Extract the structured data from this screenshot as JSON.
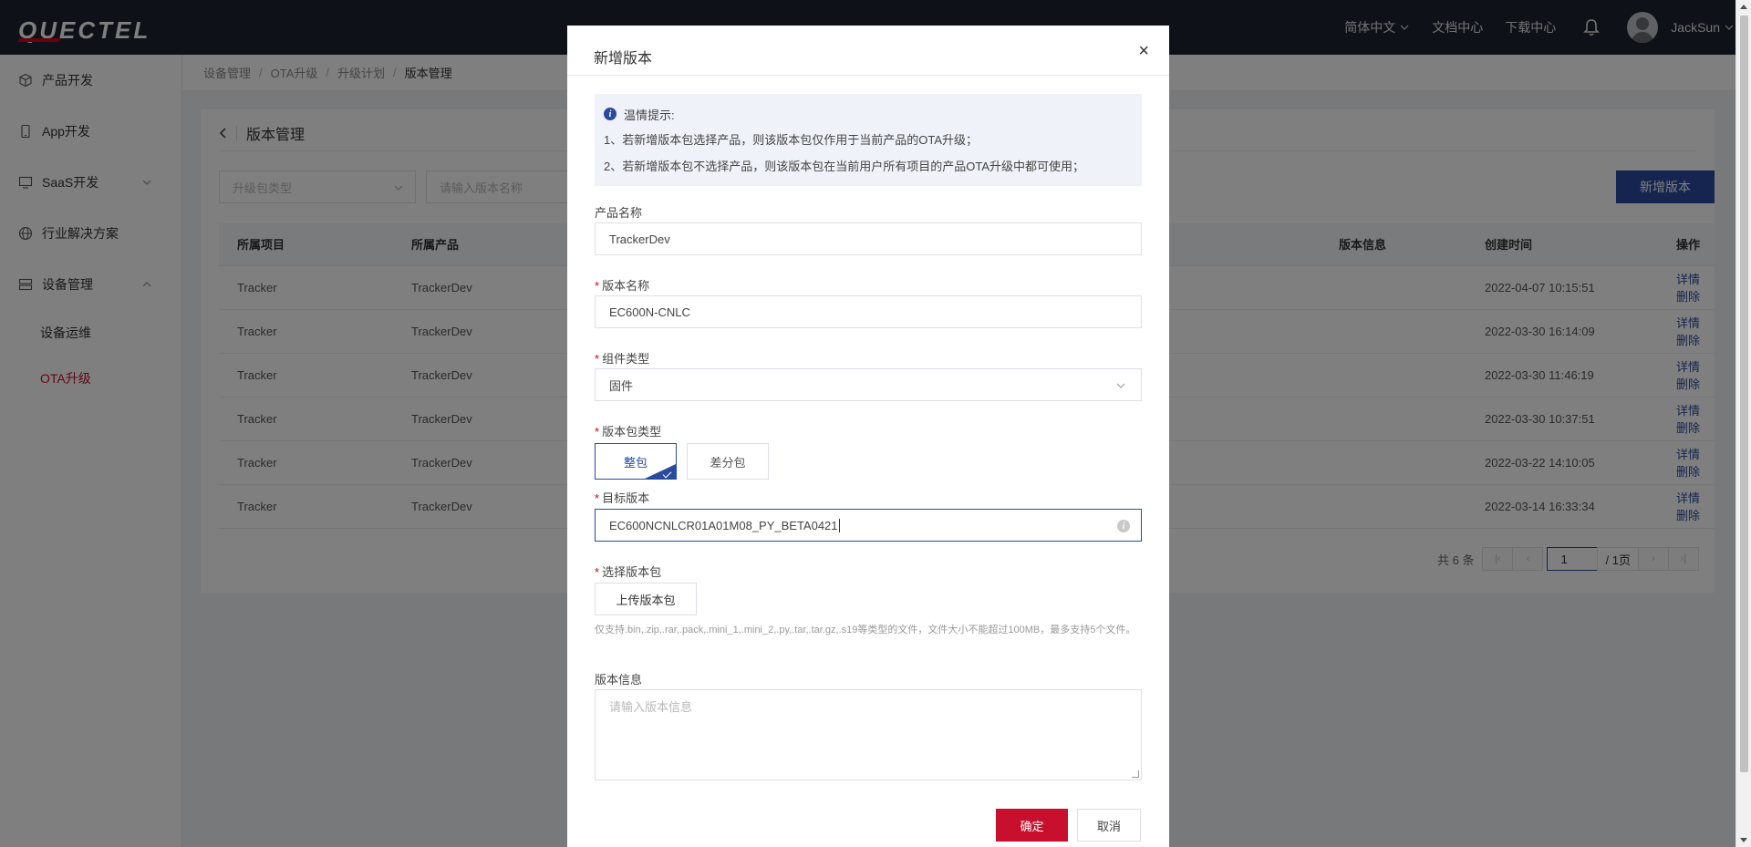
{
  "header": {
    "logo": "QUECTEL",
    "language": "简体中文",
    "docs": "文档中心",
    "downloads": "下载中心",
    "username": "JackSun"
  },
  "sidebar": {
    "items": [
      {
        "label": "产品开发",
        "icon": "cube-icon"
      },
      {
        "label": "App开发",
        "icon": "phone-icon"
      },
      {
        "label": "SaaS开发",
        "icon": "monitor-icon"
      },
      {
        "label": "行业解决方案",
        "icon": "globe-icon"
      },
      {
        "label": "设备管理",
        "icon": "grid-icon"
      }
    ],
    "sub_items": [
      {
        "label": "设备运维"
      },
      {
        "label": "OTA升级"
      }
    ]
  },
  "breadcrumb": [
    "设备管理",
    "OTA升级",
    "升级计划",
    "版本管理"
  ],
  "page": {
    "title": "版本管理",
    "filter_type_placeholder": "升级包类型",
    "filter_name_placeholder": "请输入版本名称",
    "add_button": "新增版本"
  },
  "table": {
    "columns": [
      "所属项目",
      "所属产品",
      "版本信息",
      "创建时间",
      "操作"
    ],
    "rows": [
      {
        "project": "Tracker",
        "product": "TrackerDev",
        "info": "",
        "created": "2022-04-07 10:15:51"
      },
      {
        "project": "Tracker",
        "product": "TrackerDev",
        "info": "",
        "created": "2022-03-30 16:14:09"
      },
      {
        "project": "Tracker",
        "product": "TrackerDev",
        "info": "",
        "created": "2022-03-30 11:46:19"
      },
      {
        "project": "Tracker",
        "product": "TrackerDev",
        "info": "",
        "created": "2022-03-30 10:37:51"
      },
      {
        "project": "Tracker",
        "product": "TrackerDev",
        "info": "",
        "created": "2022-03-22 14:10:05"
      },
      {
        "project": "Tracker",
        "product": "TrackerDev",
        "info": "",
        "created": "2022-03-14 16:33:34"
      }
    ],
    "action_detail": "详情",
    "action_delete": "删除"
  },
  "pagination": {
    "total": "共 6 条",
    "current": "1",
    "pages": "/ 1页"
  },
  "modal": {
    "title": "新增版本",
    "close": "×",
    "tip_title": "温情提示:",
    "tip_line1": "1、若新增版本包选择产品，则该版本包仅作用于当前产品的OTA升级；",
    "tip_line2": "2、若新增版本包不选择产品，则该版本包在当前用户所有项目的产品OTA升级中都可使用；",
    "product_label": "产品名称",
    "product_value": "TrackerDev",
    "version_name_label": "版本名称",
    "version_name_value": "EC600N-CNLC",
    "component_label": "组件类型",
    "component_value": "固件",
    "pkg_type_label": "版本包类型",
    "pkg_full": "整包",
    "pkg_diff": "差分包",
    "target_label": "目标版本",
    "target_value": "EC600NCNLCR01A01M08_PY_BETA0421",
    "upload_label": "选择版本包",
    "upload_button": "上传版本包",
    "upload_hint": "仅支持.bin,.zip,.rar,.pack,.mini_1,.mini_2,.py,.tar,.tar.gz,.s19等类型的文件，文件大小不能超过100MB，最多支持5个文件。",
    "info_label": "版本信息",
    "info_placeholder": "请输入版本信息",
    "ok": "确定",
    "cancel": "取消",
    "required_mark": "*"
  },
  "colors": {
    "primary": "#2a4a9e",
    "danger": "#c8102e",
    "topbar": "#1f2230"
  }
}
